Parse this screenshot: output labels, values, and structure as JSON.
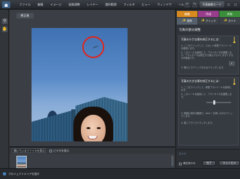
{
  "menubar": {
    "items": [
      "ファイル",
      "編集",
      "イメージ",
      "画質調整",
      "レイヤー",
      "選択範囲",
      "フィルタ",
      "ビュー",
      "ウィンドウ",
      "ヘルプ"
    ],
    "undo_label": "↶",
    "redo_label": "↷",
    "mode_label": "写真編集モード"
  },
  "toolbox": {
    "tools": [
      "search-icon",
      "hand-icon"
    ]
  },
  "document": {
    "tab_label": "補正後"
  },
  "project_bin": {
    "dropdown_value": "開いているファイルを表示",
    "option_label": "ビデオを表示"
  },
  "panel": {
    "tabs": [
      {
        "label": "編集",
        "color": "#d98a1f"
      },
      {
        "label": "作成",
        "color": "#9a3c8c"
      },
      {
        "label": "共有",
        "color": "#3c8f3a"
      }
    ],
    "subtabs": [
      {
        "label": "標準",
        "icon": "wand-icon",
        "active": true
      },
      {
        "label": "クイック",
        "icon": "wand-icon",
        "active": false
      },
      {
        "label": "ガイド",
        "icon": "wand-icon",
        "active": false
      }
    ],
    "title": "写真の部分調整",
    "section1": {
      "title": "写真の小さな傷を修正するには：",
      "step1": "1. ここをクリックして、スポット修復ブラシツールを使用します。",
      "step2": "2. このツールを使用して、ブラシサイズを調整します。ブラシサイズは修正する傷よりも少し大きくするのが最適です。",
      "step3": "3. 傷の上でクリックまたはドラッグします。"
    },
    "section2": {
      "title": "写真の大きな傷を修正するには：",
      "step1": "1. ここをクリックして、修復ブラシツールを使用します。",
      "step2": "2. このツールを使用して、ブラシサイズを調整します。",
      "step3": "3. 周囲の良好な範囲で、Altキーを押しながらクリックします。",
      "step4": "4. 傷にブラシでドラッグします。"
    },
    "done_label": "完了",
    "cancel_label": "キャンセル",
    "footer_link": "ヒント",
    "footer_check": "補正後のみ"
  },
  "statusbar": {
    "text": "プロジェクトエリアを隠す"
  }
}
